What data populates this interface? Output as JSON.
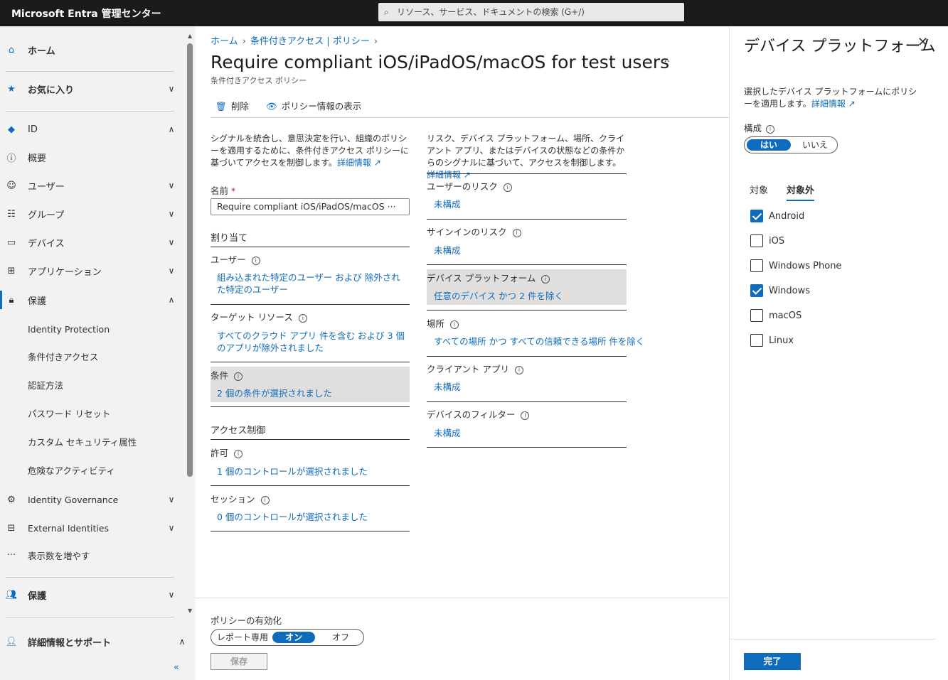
{
  "topbar": {
    "brand": "Microsoft Entra 管理センター",
    "search_placeholder": "リソース、サービス、ドキュメントの検索 (G+/)"
  },
  "sidebar": {
    "home": "ホーム",
    "favorites": "お気に入り",
    "id": "ID",
    "overview": "概要",
    "users": "ユーザー",
    "groups": "グループ",
    "devices": "デバイス",
    "applications": "アプリケーション",
    "protection": "保護",
    "identity_protection": "Identity Protection",
    "conditional_access": "条件付きアクセス",
    "auth_methods": "認証方法",
    "password_reset": "パスワード リセット",
    "custom_security": "カスタム セキュリティ属性",
    "risky_activities": "危険なアクティビティ",
    "identity_governance": "Identity Governance",
    "external_identities": "External Identities",
    "show_more": "表示数を増やす",
    "protection2": "保護",
    "learn_support": "詳細情報とサポート",
    "collapse": "«"
  },
  "main": {
    "breadcrumb": [
      "ホーム",
      "条件付きアクセス | ポリシー"
    ],
    "title": "Require compliant iOS/iPadOS/macOS for test users",
    "more": "···",
    "subtitle": "条件付きアクセス ポリシー",
    "toolbar": {
      "delete": "削除",
      "view_info": "ポリシー情報の表示"
    },
    "left_desc": "シグナルを統合し、意思決定を行い、組織のポリシーを適用するために、条件付きアクセス ポリシーに基づいてアクセスを制御します。",
    "learn_more": "詳細情報",
    "name_label": "名前",
    "required": "*",
    "name_value": "Require compliant iOS/iPadOS/macOS ···",
    "assignments": "割り当て",
    "users_label": "ユーザー",
    "users_value": "組み込まれた特定のユーザー および 除外された特定のユーザー",
    "target_label": "ターゲット リソース",
    "target_value": "すべてのクラウド アプリ 件を含む および 3 個のアプリが除外されました",
    "conditions_label": "条件",
    "conditions_value": "2 個の条件が選択されました",
    "access_controls": "アクセス制御",
    "grant_label": "許可",
    "grant_value": "1 個のコントロールが選択されました",
    "session_label": "セッション",
    "session_value": "0 個のコントロールが選択されました",
    "right_desc": "リスク、デバイス プラットフォーム、場所、クライアント アプリ、またはデバイスの状態などの条件からのシグナルに基づいて、アクセスを制御します。",
    "user_risk_label": "ユーザーのリスク",
    "user_risk_value": "未構成",
    "signin_risk_label": "サインインのリスク",
    "signin_risk_value": "未構成",
    "device_platform_label": "デバイス プラットフォーム",
    "device_platform_value": "任意のデバイス かつ 2 件を除く",
    "location_label": "場所",
    "location_value": "すべての場所 かつ すべての信頼できる場所 件を除く",
    "client_apps_label": "クライアント アプリ",
    "client_apps_value": "未構成",
    "device_filter_label": "デバイスのフィルター",
    "device_filter_value": "未構成",
    "enable_label": "ポリシーの有効化",
    "enable_options": [
      "レポート専用",
      "オン",
      "オフ"
    ],
    "save": "保存"
  },
  "panel": {
    "title": "デバイス プラットフォーム",
    "close": "✕",
    "desc": "選択したデバイス プラットフォームにポリシーを適用します。",
    "learn_more": "詳細情報",
    "configure_label": "構成",
    "toggle_yes": "はい",
    "toggle_no": "いいえ",
    "tab_include": "対象",
    "tab_exclude": "対象外",
    "platforms": [
      {
        "name": "Android",
        "checked": true
      },
      {
        "name": "iOS",
        "checked": false
      },
      {
        "name": "Windows Phone",
        "checked": false
      },
      {
        "name": "Windows",
        "checked": true
      },
      {
        "name": "macOS",
        "checked": false
      },
      {
        "name": "Linux",
        "checked": false
      }
    ],
    "done": "完了"
  },
  "colors": {
    "accent": "#0f6cbd",
    "topbar": "#1b1b1b",
    "sidebar": "#f2f2f2",
    "highlight": "#e1dfdd"
  }
}
